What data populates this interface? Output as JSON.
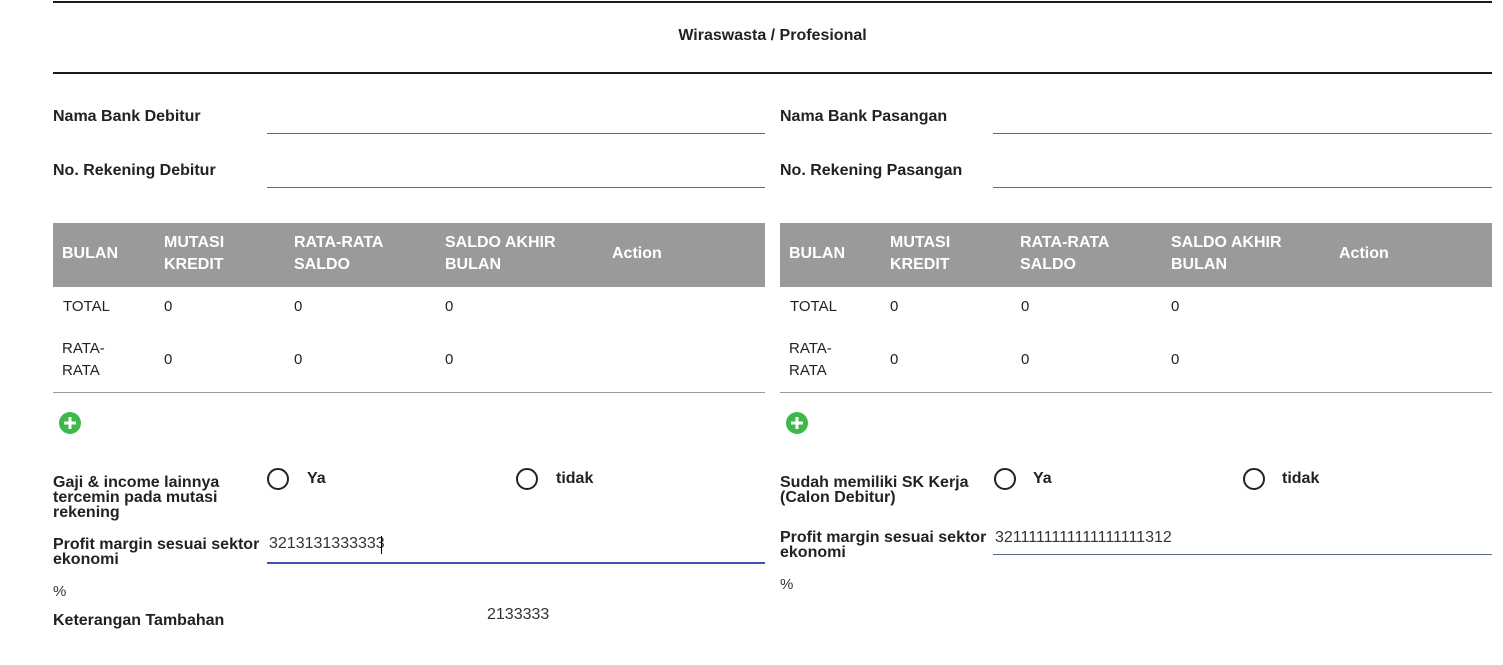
{
  "section": {
    "title": "Wiraswasta / Profesional"
  },
  "debitur": {
    "bank_label": "Nama Bank Debitur",
    "bank_value": "",
    "rekening_label": "No. Rekening Debitur",
    "rekening_value": "",
    "table": {
      "headers": [
        "BULAN",
        "MUTASI\nKREDIT",
        "RATA-RATA\nSALDO",
        "SALDO AKHIR\nBULAN",
        "Action"
      ],
      "rows": [
        {
          "bulan": "TOTAL",
          "mutasi": "0",
          "rata": "0",
          "saldo": "0"
        },
        {
          "bulan": "RATA-\nRATA",
          "mutasi": "0",
          "rata": "0",
          "saldo": "0"
        }
      ]
    },
    "question_label": "Gaji & income lainnya tercemin pada mutasi rekening",
    "option_yes": "Ya",
    "option_no": "tidak",
    "profit_label": "Profit margin sesuai sektor ekonomi",
    "profit_value": "3213131333333",
    "percent": "%",
    "keterangan_label": "Keterangan Tambahan",
    "keterangan_value": "2133333"
  },
  "pasangan": {
    "bank_label": "Nama Bank Pasangan",
    "bank_value": "",
    "rekening_label": "No. Rekening Pasangan",
    "rekening_value": "",
    "table": {
      "headers": [
        "BULAN",
        "MUTASI\nKREDIT",
        "RATA-RATA\nSALDO",
        "SALDO AKHIR\nBULAN",
        "Action"
      ],
      "rows": [
        {
          "bulan": "TOTAL",
          "mutasi": "0",
          "rata": "0",
          "saldo": "0"
        },
        {
          "bulan": "RATA-\nRATA",
          "mutasi": "0",
          "rata": "0",
          "saldo": "0"
        }
      ]
    },
    "question_label": "Sudah memiliki SK Kerja (Calon Debitur)",
    "option_yes": "Ya",
    "option_no": "tidak",
    "profit_label": "Profit margin sesuai sektor ekonomi",
    "profit_value": "3211111111111111111312",
    "percent": "%"
  },
  "colors": {
    "table_header_bg": "#9a9a9a",
    "add_icon": "#3db84a",
    "focused_underline": "#3f51b5",
    "field_underline": "#5a6b80"
  },
  "icons": {
    "add": "plus-circle-icon"
  }
}
